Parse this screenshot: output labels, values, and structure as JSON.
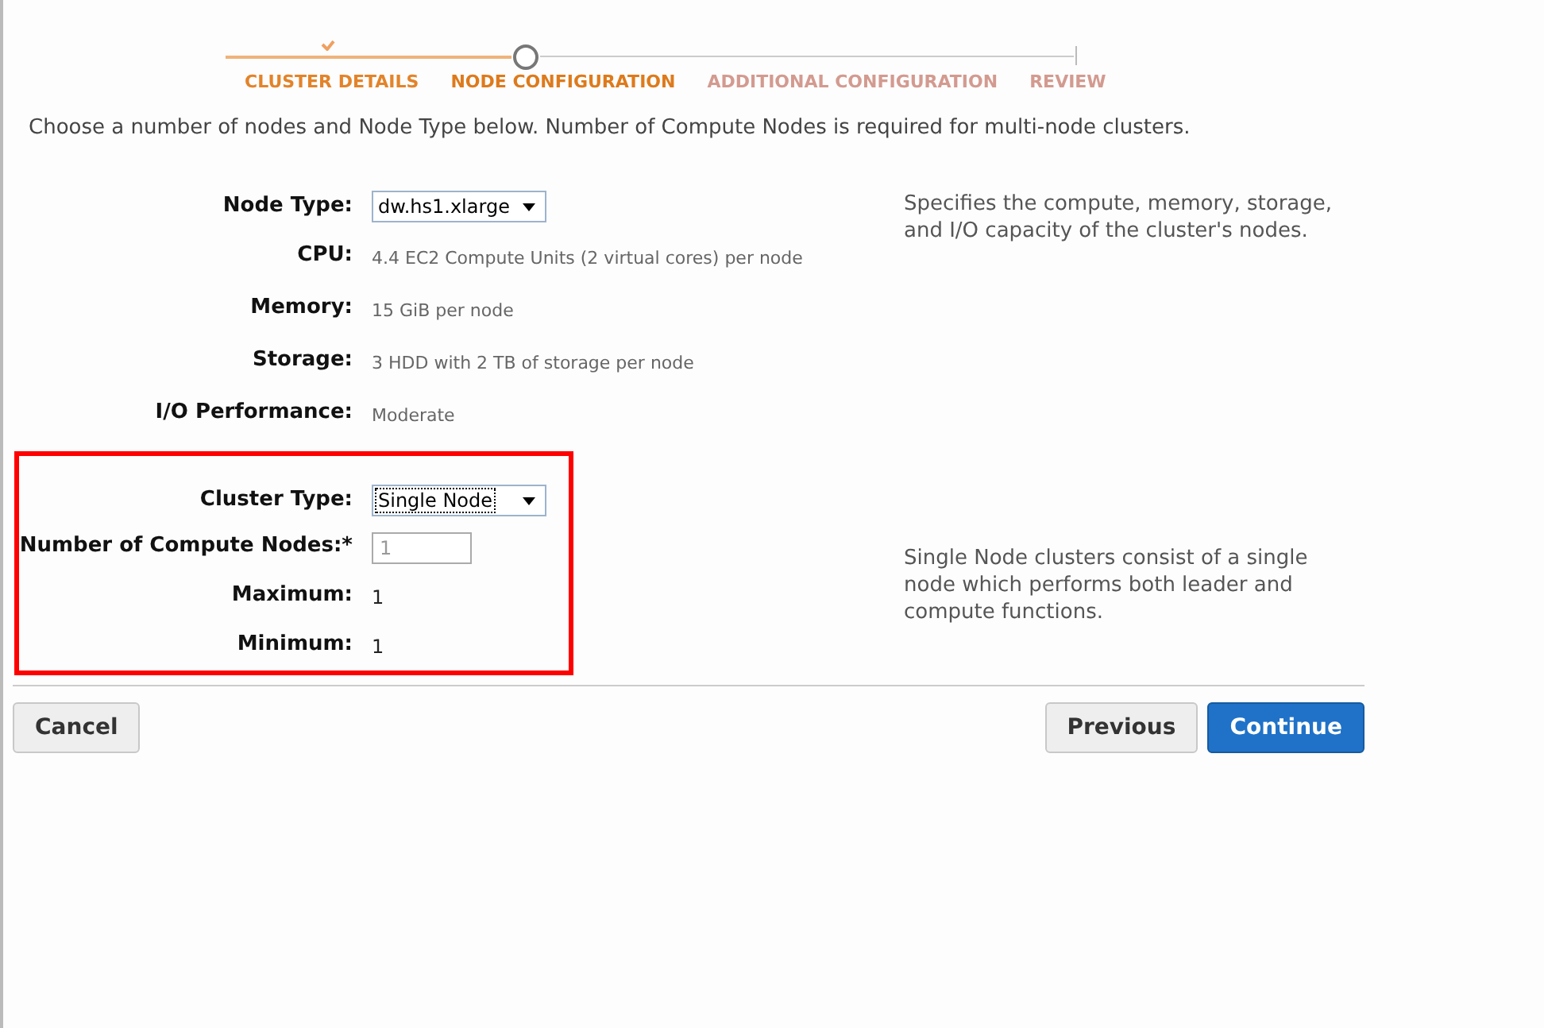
{
  "steps": [
    {
      "label": "CLUSTER DETAILS",
      "completed": true,
      "selected": false
    },
    {
      "label": "NODE CONFIGURATION",
      "completed": false,
      "selected": true
    },
    {
      "label": "ADDITIONAL CONFIGURATION",
      "completed": false,
      "selected": false
    },
    {
      "label": "REVIEW",
      "completed": false,
      "selected": false
    }
  ],
  "intro": "Choose a number of nodes and Node Type below. Number of Compute Nodes is required for multi-node clusters.",
  "node_section": {
    "fields": [
      {
        "label": "Node Type:",
        "kind": "select",
        "value": "dw.hs1.xlarge",
        "focused": false
      },
      {
        "label": "CPU:",
        "kind": "detail",
        "value": "4.4 EC2 Compute Units (2 virtual cores) per node"
      },
      {
        "label": "Memory:",
        "kind": "detail",
        "value": "15 GiB per node"
      },
      {
        "label": "Storage:",
        "kind": "detail",
        "value": "3 HDD with 2 TB of storage per node"
      },
      {
        "label": "I/O Performance:",
        "kind": "detail",
        "value": "Moderate"
      }
    ],
    "help": "Specifies the compute, memory, storage, and I/O capacity of the cluster's nodes."
  },
  "cluster_section": {
    "fields": [
      {
        "label": "Cluster Type:",
        "kind": "select",
        "value": "Single Node",
        "focused": true
      },
      {
        "label": "Number of Compute Nodes:*",
        "kind": "input",
        "value": "1",
        "disabled": true
      },
      {
        "label": "Maximum:",
        "kind": "text",
        "value": "1"
      },
      {
        "label": "Minimum:",
        "kind": "text",
        "value": "1"
      }
    ],
    "help": "Single Node clusters consist of a single node which performs both leader and compute functions."
  },
  "buttons": [
    {
      "label": "Cancel",
      "kind": "secondary"
    },
    {
      "label": "Previous",
      "kind": "secondary"
    },
    {
      "label": "Continue",
      "kind": "primary"
    }
  ]
}
